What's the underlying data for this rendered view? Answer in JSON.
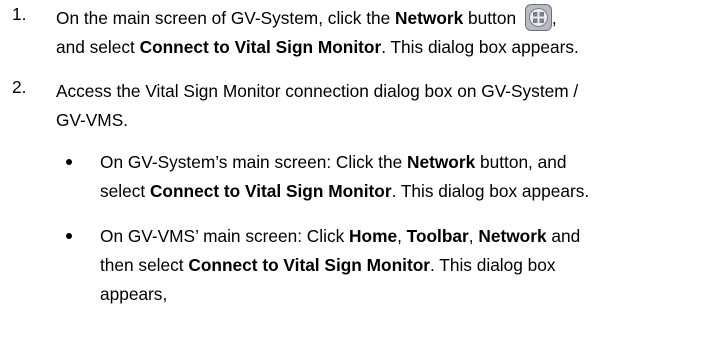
{
  "steps": [
    {
      "number": "1.",
      "line1": {
        "t1": "On the main screen of GV-System, click the ",
        "b1": "Network",
        "t2": " button ",
        "t3": ","
      },
      "line2": {
        "t1": "and select ",
        "b1": "Connect to Vital Sign Monitor",
        "t2": ". This dialog box appears."
      },
      "icon": "network-button-icon"
    },
    {
      "number": "2.",
      "line1": "Access the Vital Sign Monitor connection dialog box on GV-System /",
      "line2": "GV-VMS.",
      "bullets": [
        {
          "line1": {
            "t1": "On GV-System’s main screen: Click the ",
            "b1": "Network",
            "t2": " button, and"
          },
          "line2": {
            "t1": "select ",
            "b1": "Connect to Vital Sign Monitor",
            "t2": ". This dialog box appears."
          }
        },
        {
          "line1": {
            "t1": "On GV-VMS’ main screen: Click ",
            "b1": "Home",
            "t2": ", ",
            "b2": "Toolbar",
            "t3": ", ",
            "b3": "Network",
            "t4": " and"
          },
          "line2": {
            "t1": "then select ",
            "b1": "Connect to Vital Sign Monitor",
            "t2": ". This dialog box"
          },
          "line3": "appears,"
        }
      ]
    }
  ]
}
